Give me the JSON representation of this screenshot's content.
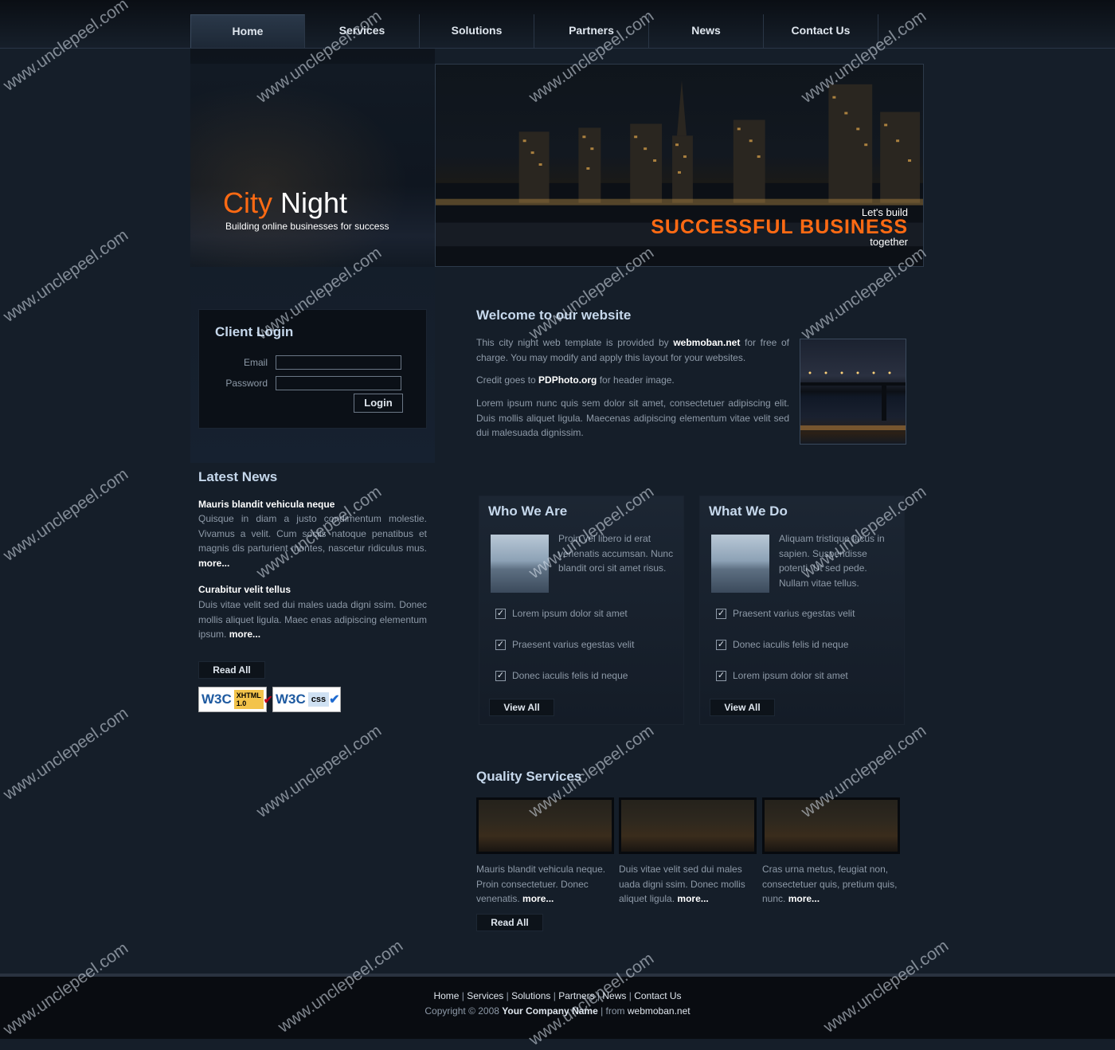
{
  "nav": [
    "Home",
    "Services",
    "Solutions",
    "Partners",
    "News",
    "Contact Us"
  ],
  "brand": {
    "word1": "City",
    "word2": "Night",
    "tagline": "Building online businesses for success"
  },
  "hero": {
    "line1": "Let's build",
    "line2": "SUCCESSFUL BUSINESS",
    "line3": "together"
  },
  "login": {
    "title": "Client Login",
    "email_label": "Email",
    "password_label": "Password",
    "email_value": "",
    "password_value": "",
    "button": "Login"
  },
  "latest_news": {
    "title": "Latest News",
    "items": [
      {
        "title": "Mauris blandit vehicula neque",
        "body": "Quisque in diam a justo condimentum molestie. Vivamus a velit. Cum sociis natoque penatibus et magnis dis parturient montes, nascetur ridiculus mus.",
        "more": "more..."
      },
      {
        "title": "Curabitur velit tellus",
        "body": "Duis vitae velit sed dui males uada digni ssim. Donec mollis aliquet ligula. Maec enas adipiscing elementum ipsum.",
        "more": "more..."
      }
    ],
    "read_all": "Read All"
  },
  "badges": {
    "xhtml": "XHTML",
    "xhtml_ver": "1.0",
    "css": "css",
    "w3c": "W3C"
  },
  "welcome": {
    "title": "Welcome to our website",
    "p1_pre": "This city night web template is provided by ",
    "p1_link": "webmoban.net",
    "p1_post": " for free of charge. You may modify and apply this layout for your websites.",
    "p2_pre": "Credit goes to ",
    "p2_link": "PDPhoto.org",
    "p2_post": " for header image.",
    "p3": "Lorem ipsum nunc quis sem dolor sit amet, consectetuer adipiscing elit. Duis mollis aliquet ligula. Maecenas adipiscing elementum vitae velit sed dui malesuada dignissim."
  },
  "who": {
    "title": "Who We Are",
    "text": "Proin vel libero id erat venenatis accumsan. Nunc blandit orci sit amet risus.",
    "items": [
      "Lorem ipsum dolor sit amet",
      "Praesent varius egestas velit",
      "Donec iaculis felis id neque"
    ],
    "button": "View All"
  },
  "what": {
    "title": "What We Do",
    "text": "Aliquam tristique lacus in sapien. Suspendisse potenti. Ut sed pede. Nullam vitae tellus.",
    "items": [
      "Praesent varius egestas velit",
      "Donec iaculis felis id neque",
      "Lorem ipsum dolor sit amet"
    ],
    "button": "View All"
  },
  "quality": {
    "title": "Quality Services",
    "items": [
      {
        "text": "Mauris blandit vehicula neque. Proin consectetuer. Donec venenatis.",
        "more": "more..."
      },
      {
        "text": "Duis vitae velit sed dui males uada digni ssim. Donec mollis aliquet ligula.",
        "more": "more..."
      },
      {
        "text": "Cras urna metus, feugiat non, consectetuer quis, pretium quis, nunc.",
        "more": "more..."
      }
    ],
    "read_all": "Read All"
  },
  "footer": {
    "links": [
      "Home",
      "Services",
      "Solutions",
      "Partners",
      "News",
      "Contact Us"
    ],
    "copy_pre": "Copyright © 2008 ",
    "company": "Your Company Name",
    "copy_mid": " | from ",
    "site": "webmoban.net"
  },
  "watermark": "www.unclepeel.com"
}
